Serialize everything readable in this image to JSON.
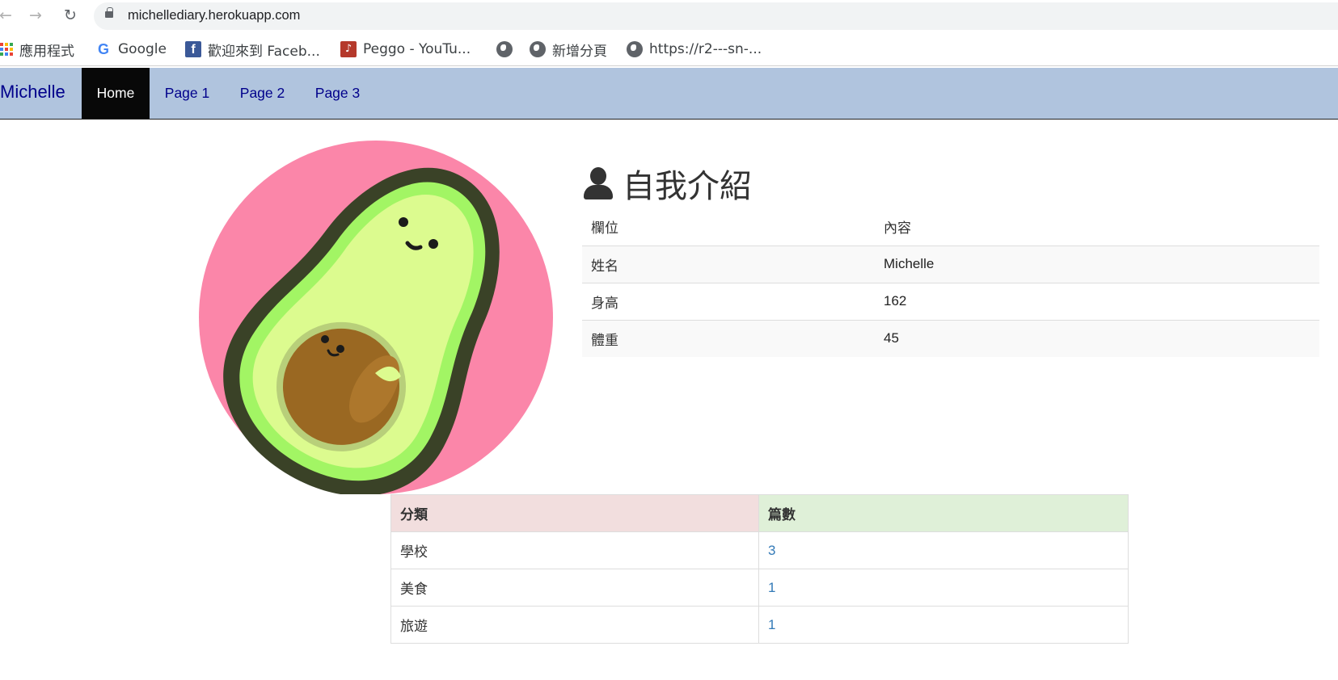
{
  "browser": {
    "url": "michellediary.herokuapp.com",
    "bookmarks": [
      {
        "label": "應用程式",
        "icon": "apps-grid-icon"
      },
      {
        "label": "Google",
        "icon": "google-icon"
      },
      {
        "label": "歡迎來到 Faceb...",
        "icon": "facebook-icon"
      },
      {
        "label": "Peggo - YouTu...",
        "icon": "peggo-icon"
      },
      {
        "label": "",
        "icon": "globe-icon"
      },
      {
        "label": "新增分頁",
        "icon": "globe-icon"
      },
      {
        "label": "https://r2---sn-...",
        "icon": "globe-icon"
      }
    ]
  },
  "navbar": {
    "brand": "Michelle",
    "items": [
      {
        "label": "Home",
        "active": true
      },
      {
        "label": "Page 1",
        "active": false
      },
      {
        "label": "Page 2",
        "active": false
      },
      {
        "label": "Page 3",
        "active": false
      }
    ],
    "background": "#b0c4de",
    "link_color": "#00008b"
  },
  "intro": {
    "title": "自我介紹",
    "icon": "user-icon",
    "headers": [
      "欄位",
      "內容"
    ],
    "rows": [
      {
        "field": "姓名",
        "value": "Michelle"
      },
      {
        "field": "身高",
        "value": "162"
      },
      {
        "field": "體重",
        "value": "45"
      }
    ]
  },
  "avatar": {
    "icon": "avocado-avatar",
    "background": "#fb86a9"
  },
  "categories": {
    "headers": [
      "分類",
      "篇數"
    ],
    "rows": [
      {
        "name": "學校",
        "count": "3"
      },
      {
        "name": "美食",
        "count": "1"
      },
      {
        "name": "旅遊",
        "count": "1"
      }
    ],
    "header_colors": {
      "category": "#f2dede",
      "count": "#dff0d8"
    }
  }
}
